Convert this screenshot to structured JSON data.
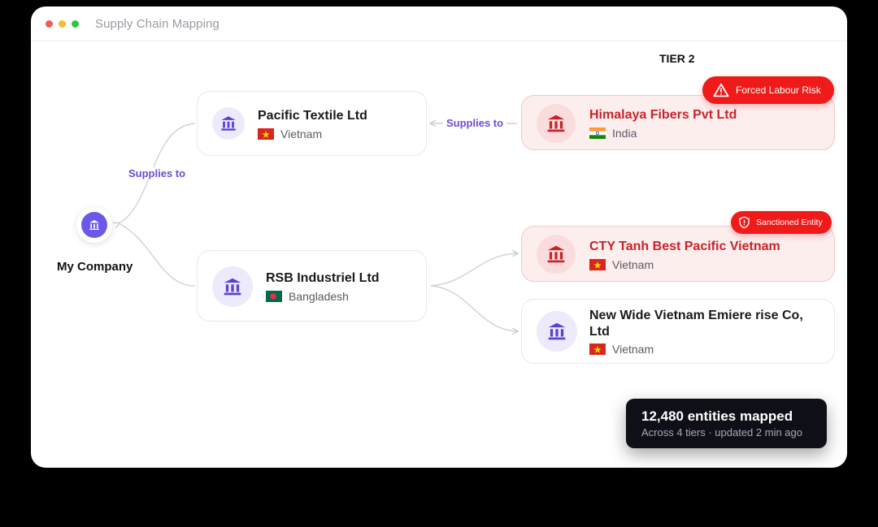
{
  "window": {
    "title": "Supply Chain Mapping"
  },
  "tier_label": "TIER 2",
  "root": {
    "label": "My Company"
  },
  "edge_labels": {
    "tier1": "Supplies to",
    "tier2": "Supplies to"
  },
  "suppliers": {
    "pacific": {
      "name": "Pacific Textile Ltd",
      "country": "Vietnam",
      "flag": "vietnam-flag"
    },
    "rsb": {
      "name": "RSB Industriel Ltd",
      "country": "Bangladesh",
      "flag": "bangladesh-flag"
    },
    "himalaya": {
      "name": "Himalaya Fibers Pvt Ltd",
      "country": "India",
      "flag": "india-flag",
      "risk": true
    },
    "cty": {
      "name": "CTY Tanh Best Pacific Vietnam",
      "country": "Vietnam",
      "flag": "vietnam-flag",
      "risk": true
    },
    "newwide": {
      "name": "New Wide Vietnam Emiere rise Co, Ltd",
      "country": "Vietnam",
      "flag": "vietnam-flag"
    }
  },
  "badges": {
    "forced_labour": {
      "label": "Forced Labour Risk",
      "icon": "warning-triangle-icon"
    },
    "sanctioned": {
      "label": "Sanctioned Entity",
      "icon": "shield-alert-icon"
    }
  },
  "toast": {
    "title": "12,480 entities mapped",
    "subtitle": "Across 4 tiers · updated 2 min ago"
  },
  "colors": {
    "accent": "#6a58e8",
    "accent_text": "#6c4cd8",
    "risk_red": "#f01a1a",
    "risk_text": "#c8232a",
    "risk_bg": "#fdeeee"
  }
}
